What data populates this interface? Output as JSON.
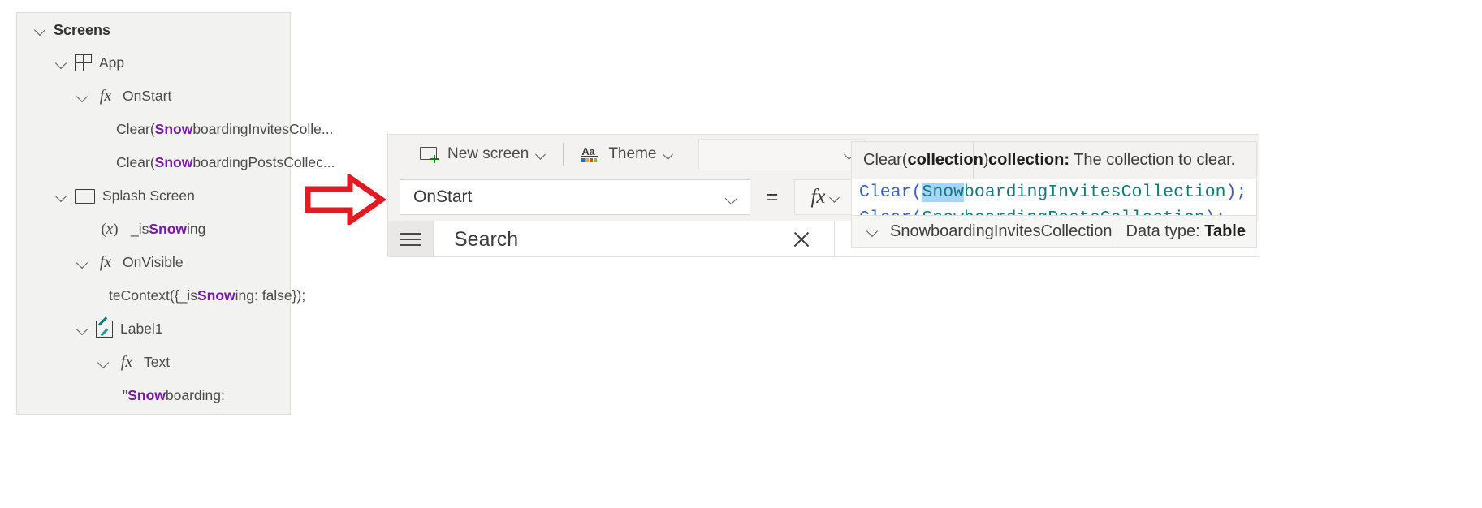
{
  "tree_panel": {
    "highlight_term": "Snow",
    "highlight_color": "#7719aa",
    "items": [
      {
        "label": "Screens",
        "icon": "none",
        "indent": 0,
        "chevron": true,
        "bold": true,
        "prefix": "Screens",
        "match": "",
        "suffix": ""
      },
      {
        "label": "App",
        "icon": "app-grid-icon",
        "indent": 1,
        "chevron": true,
        "bold": false,
        "prefix": "App",
        "match": "",
        "suffix": ""
      },
      {
        "label": "OnStart",
        "icon": "fx-icon",
        "indent": 2,
        "chevron": true,
        "bold": false,
        "prefix": "OnStart",
        "match": "",
        "suffix": ""
      },
      {
        "label": "Clear(SnowboardingInvitesColle...",
        "icon": "none",
        "indent": 3,
        "chevron": false,
        "bold": false,
        "prefix": "Clear(",
        "match": "Snow",
        "suffix": "boardingInvitesColle..."
      },
      {
        "label": "Clear(SnowboardingPostsCollec...",
        "icon": "none",
        "indent": 3,
        "chevron": false,
        "bold": false,
        "prefix": "Clear(",
        "match": "Snow",
        "suffix": "boardingPostsCollec..."
      },
      {
        "label": "Splash Screen",
        "icon": "screen-icon",
        "indent": 1,
        "chevron": true,
        "bold": false,
        "prefix": "Splash Screen",
        "match": "",
        "suffix": ""
      },
      {
        "label": "_isSnowing",
        "icon": "variable-x-icon",
        "indent": 2,
        "chevron": false,
        "bold": false,
        "prefix": "_is",
        "match": "Snow",
        "suffix": "ing"
      },
      {
        "label": "OnVisible",
        "icon": "fx-icon",
        "indent": 2,
        "chevron": true,
        "bold": false,
        "prefix": "OnVisible",
        "match": "",
        "suffix": ""
      },
      {
        "label": "teContext({_isSnowing: false});",
        "icon": "none",
        "indent": 3,
        "chevron": false,
        "bold": false,
        "prefix": "teContext({_is",
        "match": "Snow",
        "suffix": "ing: false});"
      },
      {
        "label": "Label1",
        "icon": "label-icon",
        "indent": 2,
        "chevron": true,
        "bold": false,
        "prefix": "Label1",
        "match": "",
        "suffix": ""
      },
      {
        "label": "Text",
        "icon": "fx-icon",
        "indent": 3,
        "chevron": true,
        "bold": false,
        "prefix": "Text",
        "match": "",
        "suffix": ""
      },
      {
        "label": "\"Snowboarding:",
        "icon": "none",
        "indent": 4,
        "chevron": false,
        "bold": false,
        "prefix": "\"",
        "match": "Snow",
        "suffix": "boarding:"
      }
    ]
  },
  "callout": {
    "arrow_name": "red-right-arrow",
    "color": "#e01b24"
  },
  "studio": {
    "toolbar": {
      "new_screen_label": "New screen",
      "theme_label": "Theme",
      "theme_icon_text": "Aa",
      "blank_dropdown_value": ""
    },
    "property_select": {
      "value": "OnStart"
    },
    "equals_sign": "=",
    "fx_label": "fx",
    "search": {
      "value": "Search",
      "placeholder": "Search"
    },
    "formula_lines": [
      {
        "fn": "Clear",
        "open": "(",
        "match": "Snow",
        "ident": "boardingInvitesCollection",
        "close": ");"
      },
      {
        "fn": "Clear",
        "open": "(",
        "match": "Snow",
        "ident": "boardingPostsCollection",
        "close": ");"
      }
    ]
  },
  "intellisense": {
    "signature_prefix": "Clear(",
    "signature_param": "collection",
    "signature_suffix": ")",
    "description_param": "collection:",
    "description_text": "The collection to clear.",
    "suggestion": {
      "name": "SnowboardingInvitesCollection",
      "datatype_label": "Data type:",
      "datatype_value": "Table"
    }
  }
}
